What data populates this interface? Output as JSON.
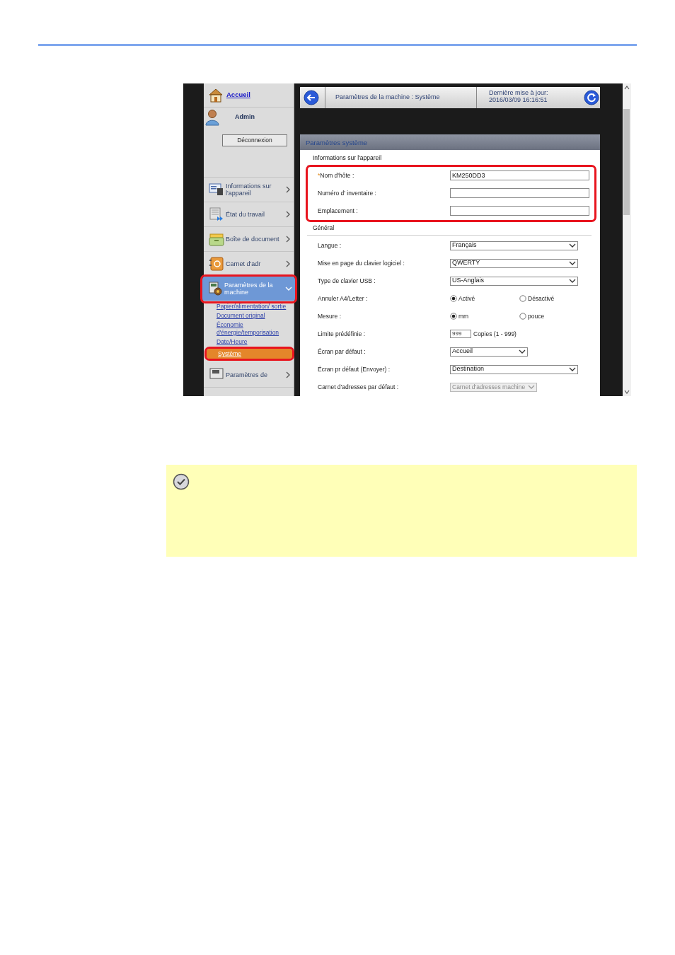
{
  "top_bar": {
    "title": "Paramètres de la machine : Système",
    "update_label": "Dernière mise à jour:",
    "update_time": "2016/03/09 16:16:51"
  },
  "sidebar": {
    "home_link": "Accueil",
    "user": "Admin",
    "logout_button": "Déconnexion",
    "items": [
      {
        "label": "Informations sur l'appareil",
        "expanded": false,
        "highlighted": false
      },
      {
        "label": "État du travail",
        "expanded": false,
        "highlighted": false
      },
      {
        "label": "Boîte de document",
        "expanded": false,
        "highlighted": false
      },
      {
        "label": "Carnet d'adr",
        "expanded": false,
        "highlighted": false
      },
      {
        "label": "Paramètres de la machine",
        "expanded": true,
        "highlighted": true,
        "children": [
          {
            "label": "Papier/alimentation/ sortie",
            "selected": false,
            "highlighted": false
          },
          {
            "label": "Document original",
            "selected": false,
            "highlighted": false
          },
          {
            "label": "Économie d'énergie/temporisation",
            "selected": false,
            "highlighted": false
          },
          {
            "label": "Date/Heure",
            "selected": false,
            "highlighted": false
          },
          {
            "label": "Système",
            "selected": true,
            "highlighted": true
          }
        ]
      },
      {
        "label": "Paramètres de",
        "expanded": false,
        "highlighted": false
      }
    ]
  },
  "panel": {
    "title": "Paramètres système",
    "sections": [
      {
        "title": "Informations sur l'appareil",
        "highlighted": true,
        "rows": [
          {
            "kind": "text",
            "label": "Nom d'hôte :",
            "required_mark": "*",
            "value": "KM250DD3"
          },
          {
            "kind": "text",
            "label": "Numéro d' inventaire :"
          },
          {
            "kind": "text",
            "label": "Emplacement :"
          }
        ]
      },
      {
        "title": "Général",
        "highlighted": false,
        "rows": [
          {
            "kind": "select",
            "label": "Langue :",
            "value": "Français",
            "disabled": false
          },
          {
            "kind": "select",
            "label": "Mise en page du clavier logiciel :",
            "value": "QWERTY",
            "disabled": false
          },
          {
            "kind": "select",
            "label": "Type de clavier USB :",
            "value": "US-Anglais",
            "disabled": false
          },
          {
            "kind": "radio",
            "label": "Annuler A4/Letter :",
            "options": [
              {
                "label": "Activé",
                "selected": true
              },
              {
                "label": "Désactivé",
                "selected": false
              }
            ]
          },
          {
            "kind": "radio",
            "label": "Mesure :",
            "options": [
              {
                "label": "mm",
                "selected": true
              },
              {
                "label": "pouce",
                "selected": false
              }
            ]
          },
          {
            "kind": "number",
            "label": "Limite prédéfinie :",
            "value": "999",
            "suffix": "Copies (1 - 999)"
          },
          {
            "kind": "select",
            "label": "Écran par défaut :",
            "value": "Accueil",
            "disabled": false,
            "short": true
          },
          {
            "kind": "select",
            "label": "Écran pr défaut (Envoyer) :",
            "value": "Destination",
            "disabled": false
          },
          {
            "kind": "select",
            "label": "Carnet d'adresses par défaut :",
            "value": "Carnet d'adresses machine",
            "disabled": true,
            "short": true
          }
        ]
      }
    ]
  }
}
